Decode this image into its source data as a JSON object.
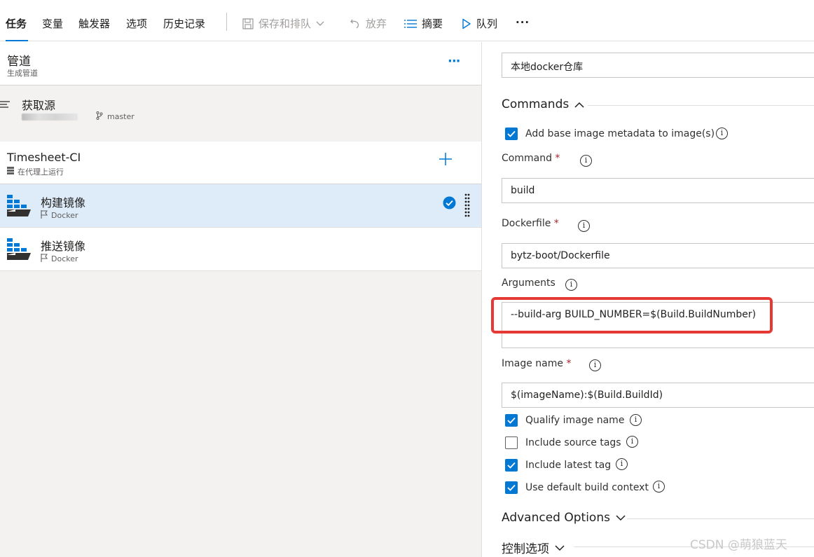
{
  "tabs": [
    {
      "label": "任务",
      "active": true
    },
    {
      "label": "变量"
    },
    {
      "label": "触发器"
    },
    {
      "label": "选项"
    },
    {
      "label": "历史记录"
    }
  ],
  "toolbar": {
    "save_label": "保存和排队",
    "discard_label": "放弃",
    "summary_label": "摘要",
    "queue_label": "队列",
    "more": "···"
  },
  "pipeline": {
    "title": "管道",
    "subtitle": "生成管道",
    "more": "···"
  },
  "source": {
    "title": "获取源",
    "branch": "master"
  },
  "job": {
    "title": "Timesheet-CI",
    "subtitle": "在代理上运行"
  },
  "tasks": [
    {
      "title": "构建镜像",
      "subtitle": "Docker",
      "selected": true
    },
    {
      "title": "推送镜像",
      "subtitle": "Docker",
      "selected": false
    }
  ],
  "details": {
    "registry_value": "本地docker仓库",
    "commands_section": "Commands",
    "add_metadata_label": "Add base image metadata to image(s)",
    "command_label": "Command",
    "command_value": "build",
    "dockerfile_label": "Dockerfile",
    "dockerfile_value": "bytz-boot/Dockerfile",
    "arguments_label": "Arguments",
    "arguments_value": "--build-arg BUILD_NUMBER=$(Build.BuildNumber)",
    "image_name_label": "Image name",
    "image_name_value": "$(imageName):$(Build.BuildId)",
    "required_mark": "*",
    "info_glyph": "i",
    "checkboxes": [
      {
        "label": "Qualify image name",
        "checked": true
      },
      {
        "label": "Include source tags",
        "checked": false
      },
      {
        "label": "Include latest tag",
        "checked": true
      },
      {
        "label": "Use default build context",
        "checked": true
      }
    ],
    "advanced_section": "Advanced Options",
    "control_section": "控制选项"
  },
  "watermark": "CSDN @萌狼蓝天",
  "colors": {
    "accent": "#0078d4",
    "highlight": "#e53935",
    "selected_row": "#deecf9"
  }
}
